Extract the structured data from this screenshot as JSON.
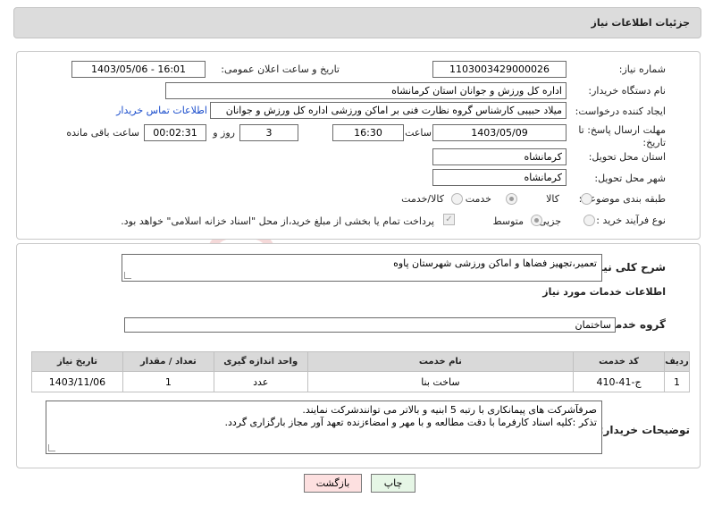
{
  "header": {
    "title": "جزئیات اطلاعات نیاز"
  },
  "fields": {
    "need_number_label": "شماره نیاز:",
    "need_number": "1103003429000026",
    "announce_label": "تاریخ و ساعت اعلان عمومی:",
    "announce_value": "1403/05/06 - 16:01",
    "buyer_label": "نام دستگاه خریدار:",
    "buyer_value": "اداره کل ورزش و جوانان استان کرمانشاه",
    "creator_label": "ایجاد کننده درخواست:",
    "creator_value": "میلاد حبیبی کارشناس گروه نظارت فنی بر اماکن ورزشی اداره کل ورزش و جوانان",
    "contact_link": "اطلاعات تماس خریدار",
    "deadline_label": "مهلت ارسال پاسخ: تا تاریخ:",
    "deadline_date": "1403/05/09",
    "time_label": "ساعت",
    "deadline_time": "16:30",
    "days_value": "3",
    "days_label": "روز و",
    "remaining_value": "00:02:31",
    "remaining_label": "ساعت باقی مانده",
    "province_label": "استان محل تحویل:",
    "province_value": "کرمانشاه",
    "city_label": "شهر محل تحویل:",
    "city_value": "کرمانشاه",
    "category_label": "طبقه بندی موضوعی:",
    "category_options": [
      "کالا",
      "خدمت",
      "کالا/خدمت"
    ],
    "process_label": "نوع فرآیند خرید :",
    "process_options": [
      "جزیی",
      "متوسط"
    ],
    "payment_text": "پرداخت تمام یا بخشی از مبلغ خرید،از محل \"اسناد خزانه اسلامی\" خواهد بود."
  },
  "summary": {
    "label": "شرح کلی نیاز:",
    "value": "تعمیر،تجهیز فضاها و اماکن ورزشی شهرستان پاوه"
  },
  "services": {
    "section_title": "اطلاعات خدمات مورد نیاز",
    "group_label": "گروه خدمت:",
    "group_value": "ساختمان",
    "columns": [
      "ردیف",
      "کد خدمت",
      "نام خدمت",
      "واحد اندازه گیری",
      "تعداد / مقدار",
      "تاریخ نیاز"
    ],
    "rows": [
      [
        "1",
        "ج-41-410",
        "ساخت بنا",
        "عدد",
        "1",
        "1403/11/06"
      ]
    ]
  },
  "buyer_notes": {
    "label": "توضیحات خریدار:",
    "line1": "صرفآشرکت های پیمانکاری با رتبه 5 ابنیه و بالاتر می توانندشرکت نمایند.",
    "line2": "تذکر :کلیه اسناد کارفرما با دقت مطالعه و با مهر و امضاءزنده تعهد آور مجاز بارگزاری گردد."
  },
  "buttons": {
    "print": "چاپ",
    "back": "بازگشت"
  },
  "colors": {
    "accent_link": "#1a4dcc",
    "header_bg": "#dcdcdc",
    "back_bg": "#fde0e0",
    "print_bg": "#e6f6e6"
  }
}
